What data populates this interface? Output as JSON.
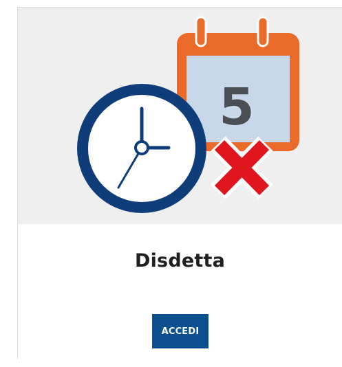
{
  "card": {
    "title": "Disdetta",
    "button_label": "ACCEDI",
    "illustration": {
      "calendar_icon": "calendar-icon",
      "calendar_day": "5",
      "clock_icon": "clock-icon",
      "cancel_icon": "cancel-x-icon"
    }
  },
  "colors": {
    "image_background": "#efefef",
    "calendar_orange": "#ea6a2a",
    "calendar_page": "#c8d8ea",
    "clock_blue": "#0f3d7a",
    "cancel_red": "#e0161e",
    "button_blue": "#0b4f8f"
  }
}
